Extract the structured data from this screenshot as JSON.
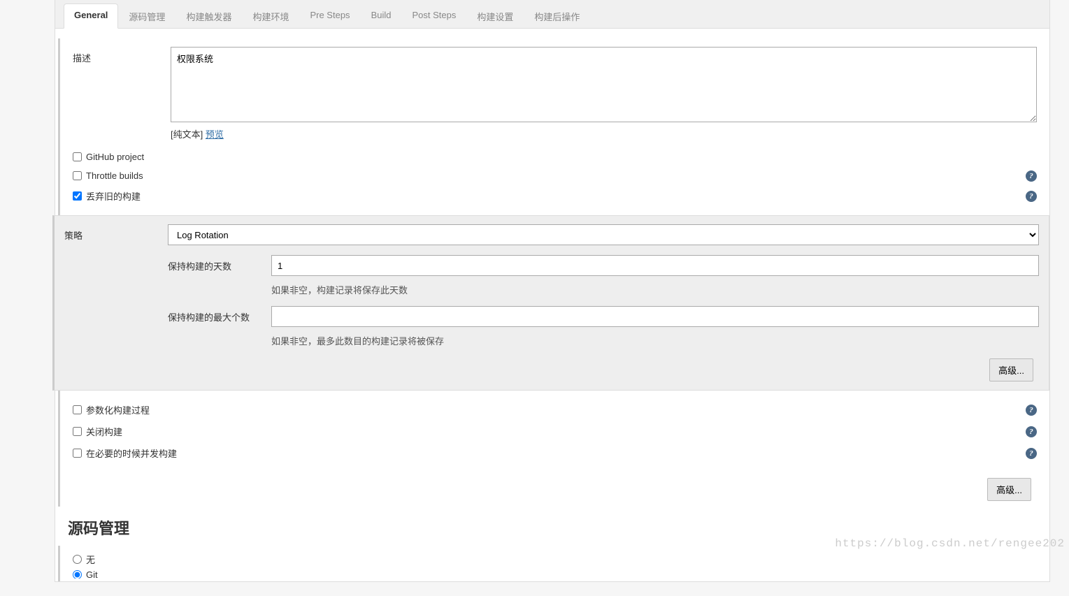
{
  "tabs": [
    {
      "label": "General",
      "active": true
    },
    {
      "label": "源码管理",
      "active": false
    },
    {
      "label": "构建触发器",
      "active": false
    },
    {
      "label": "构建环境",
      "active": false
    },
    {
      "label": "Pre Steps",
      "active": false
    },
    {
      "label": "Build",
      "active": false
    },
    {
      "label": "Post Steps",
      "active": false
    },
    {
      "label": "构建设置",
      "active": false
    },
    {
      "label": "构建后操作",
      "active": false
    }
  ],
  "description": {
    "label": "描述",
    "value": "权限系统",
    "plain_text_label": "[纯文本]",
    "preview_label": "预览"
  },
  "options": {
    "github_project": {
      "label": "GitHub project",
      "checked": false
    },
    "throttle_builds": {
      "label": "Throttle builds",
      "checked": false
    },
    "discard_old_builds": {
      "label": "丢弃旧的构建",
      "checked": true
    },
    "parameterized": {
      "label": "参数化构建过程",
      "checked": false
    },
    "disable_build": {
      "label": "关闭构建",
      "checked": false
    },
    "concurrent": {
      "label": "在必要的时候并发构建",
      "checked": false
    }
  },
  "strategy": {
    "label": "策略",
    "selected": "Log Rotation",
    "days_to_keep": {
      "label": "保持构建的天数",
      "value": "1",
      "hint": "如果非空，构建记录将保存此天数"
    },
    "max_to_keep": {
      "label": "保持构建的最大个数",
      "value": "",
      "hint": "如果非空，最多此数目的构建记录将被保存"
    }
  },
  "advanced_button": "高级...",
  "scm": {
    "title": "源码管理",
    "none": {
      "label": "无",
      "checked": false
    },
    "git": {
      "label": "Git",
      "checked": true
    }
  },
  "watermark": "https://blog.csdn.net/rengee202"
}
